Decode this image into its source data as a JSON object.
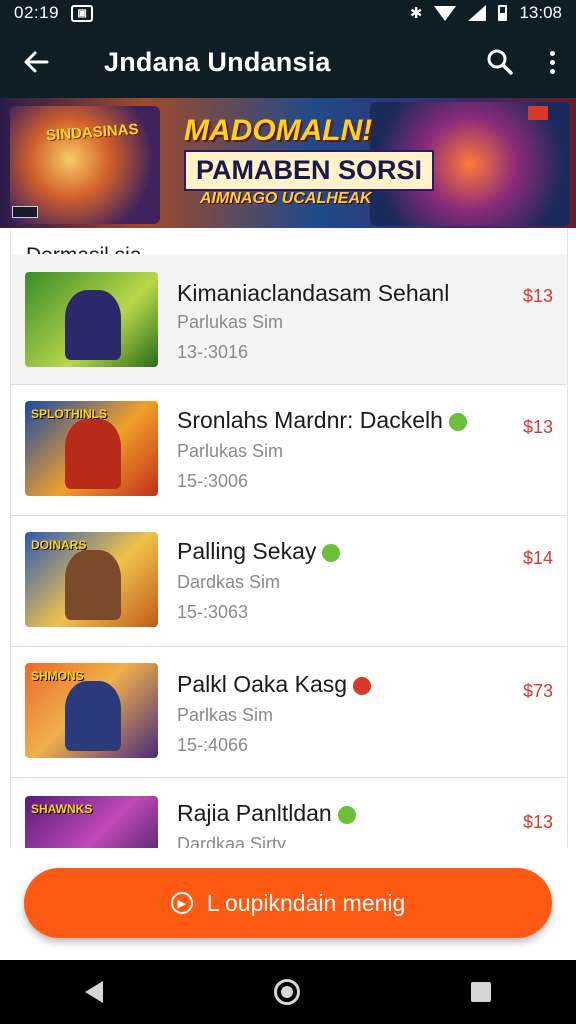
{
  "status_bar": {
    "time_left": "02:19",
    "time_right": "13:08"
  },
  "app_bar": {
    "title": "Jndana Undansia"
  },
  "banner": {
    "headline": "MADOMALN!",
    "subline": "PAMABEN SORSI",
    "tagline": "AIMNAGO UCALHEAK",
    "left_art_text": "SINDASINAS"
  },
  "section": {
    "title": "Dermasil sia"
  },
  "items": [
    {
      "title": "Kimaniaclandasam Sehanl",
      "subtitle": "Parlukas Sim",
      "meta": "13-:3016",
      "price": "$13",
      "badge_color": ""
    },
    {
      "title": "Sronlahs Mardnr: Dackelh",
      "subtitle": "Parlukas Sim",
      "meta": "15-:3006",
      "price": "$13",
      "badge_color": "#6bbf3a"
    },
    {
      "title": "Palling Sekay",
      "subtitle": "Dardkas Sim",
      "meta": "15-:3063",
      "price": "$14",
      "badge_color": "#6bbf3a"
    },
    {
      "title": "Palkl Oaka Kasg",
      "subtitle": "Parlkas Sim",
      "meta": "15-:4066",
      "price": "$73",
      "badge_color": "#d8382a"
    },
    {
      "title": "Rajia Panltldan",
      "subtitle": "Dardkaa Sirty",
      "meta": "",
      "price": "$13",
      "badge_color": "#6bbf3a"
    }
  ],
  "thumb_labels": [
    "",
    "SPLOTHINLS",
    "DOINARS",
    "SHMONS",
    "SHAWNKS"
  ],
  "cta": {
    "label": "L oupikndain menig"
  },
  "colors": {
    "appbar": "#0f1d25",
    "accent": "#ff5a14",
    "price": "#d8382a"
  }
}
